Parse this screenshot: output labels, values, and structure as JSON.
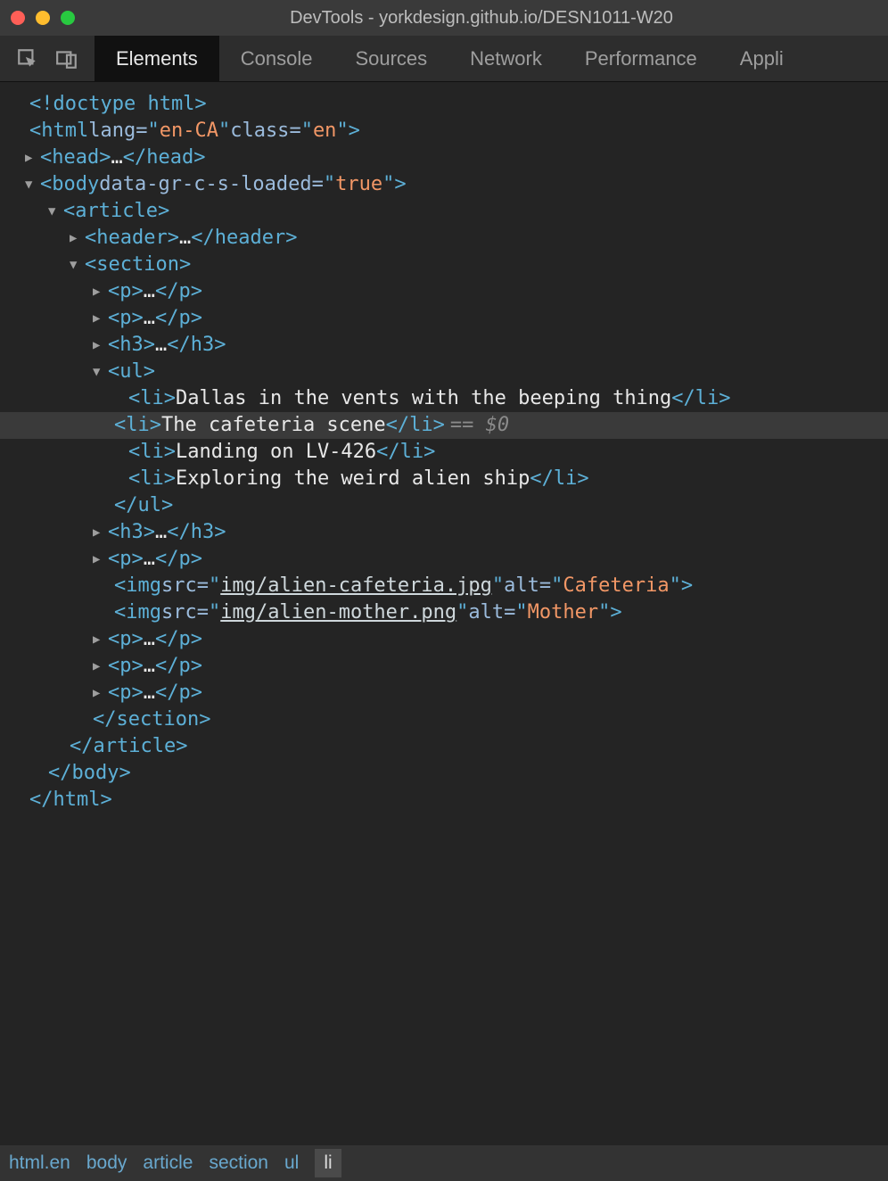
{
  "window": {
    "title": "DevTools - yorkdesign.github.io/DESN1011-W20"
  },
  "tabs": {
    "elements": "Elements",
    "console": "Console",
    "sources": "Sources",
    "network": "Network",
    "performance": "Performance",
    "application": "Appli"
  },
  "dom": {
    "doctype": "<!doctype html>",
    "html_attrs": {
      "lang_name": "lang",
      "lang_val": "en-CA",
      "class_name": "class",
      "class_val": "en"
    },
    "body_attrs": {
      "name": "data-gr-c-s-loaded",
      "val": "true"
    },
    "li1": "Dallas in the vents with the beeping thing",
    "li2": "The cafeteria scene",
    "li3": "Landing on LV-426",
    "li4": "Exploring the weird alien ship",
    "img1": {
      "src": "img/alien-cafeteria.jpg",
      "alt": "Cafeteria"
    },
    "img2": {
      "src": "img/alien-mother.png",
      "alt": "Mother"
    },
    "sel_hint": "== $0",
    "tags": {
      "html": "html",
      "head": "head",
      "body": "body",
      "article": "article",
      "header": "header",
      "section": "section",
      "p": "p",
      "h3": "h3",
      "ul": "ul",
      "li": "li",
      "img": "img",
      "src": "src",
      "alt": "alt"
    },
    "ellipsis": "…",
    "gutter_dots": "…"
  },
  "breadcrumbs": [
    "html.en",
    "body",
    "article",
    "section",
    "ul",
    "li"
  ]
}
